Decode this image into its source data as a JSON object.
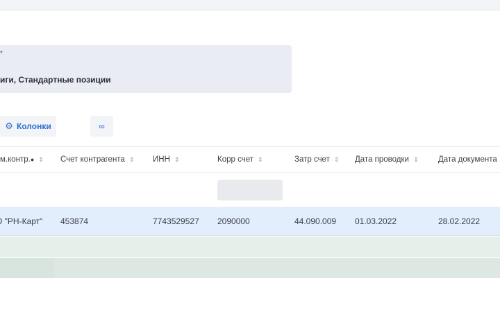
{
  "panel": {
    "label_fragment": "*",
    "value": "иги, Стандартные позиции"
  },
  "toolbar": {
    "columns_label": "Колонки",
    "link_label": "∞"
  },
  "table": {
    "headers": [
      "м.контр.",
      "Счет контрагента",
      "ИНН",
      "Корр счет",
      "Затр счет",
      "Дата проводки",
      "Дата документа"
    ],
    "rows": [
      [
        "О \"РН-Карт\"",
        "453874",
        "7743529527",
        "2090000",
        "44.090.009",
        "01.03.2022",
        "28.02.2022"
      ]
    ]
  },
  "colors": {
    "accent": "#2f6fd1",
    "selected_row": "#e3eefc",
    "group_row": "#e6efe9"
  }
}
